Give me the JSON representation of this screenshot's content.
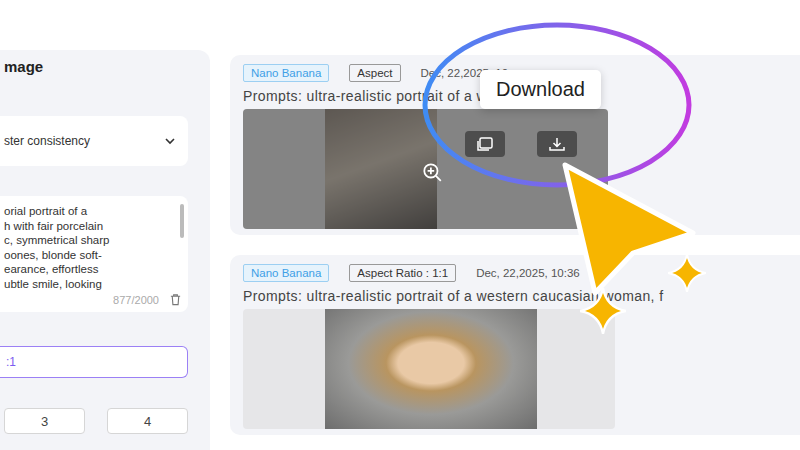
{
  "panel": {
    "title": "mage",
    "dropdown": {
      "value": "ster consistency"
    },
    "prompt": {
      "lines": [
        "orial portrait of a",
        "h with fair porcelain",
        "c, symmetrical sharp",
        "oones, blonde soft-",
        "earance, effortless",
        "ubtle smile, looking"
      ],
      "count": "877/2000"
    },
    "aspect_ratio": {
      "value": ":1",
      "selected": true
    },
    "quantity": [
      {
        "label": "3",
        "selected": false
      },
      {
        "label": "4",
        "selected": false
      }
    ]
  },
  "history": [
    {
      "model": "Nano Banana",
      "aspect": "Aspect",
      "date": "Dec, 22,2025, 10:",
      "prompt": "Prompts: ultra-realistic portrait of a western cau",
      "hovered": true
    },
    {
      "model": "Nano Banana",
      "aspect": "Aspect Ratio : 1:1",
      "date": "Dec, 22,2025, 10:36",
      "prompt": "Prompts: ultra-realistic portrait of a western caucasian woman, f",
      "hovered": false
    }
  ],
  "tooltip": {
    "text": "Download"
  }
}
